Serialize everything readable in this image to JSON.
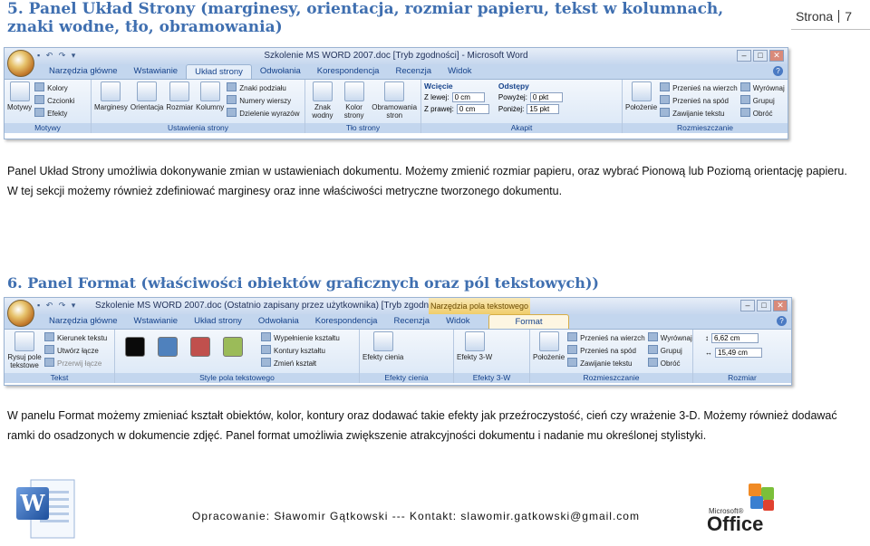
{
  "header": {
    "title": "5. Panel Układ Strony (marginesy, orientacja, rozmiar papieru, tekst w kolumnach, znaki wodne, tło, obramowania)",
    "page_label": "Strona",
    "page_number": "7"
  },
  "section5": {
    "paragraph": "Panel Układ Strony umożliwia dokonywanie zmian w ustawieniach dokumentu. Możemy zmienić rozmiar papieru, oraz wybrać Pionową lub Poziomą orientację papieru. W tej sekcji możemy również zdefiniować marginesy oraz inne właściwości metryczne tworzonego dokumentu."
  },
  "section6": {
    "title": "6. Panel Format (właściwości obiektów graficznych oraz pól tekstowych))",
    "paragraph": "W panelu Format możemy zmieniać kształt obiektów, kolor, kontury oraz dodawać takie efekty jak przeźroczystość, cień czy wrażenie 3-D. Możemy również dodawać ramki do osadzonych w dokumencie zdjęć. Panel format umożliwia zwiększenie atrakcyjności dokumentu i nadanie mu określonej stylistyki."
  },
  "ribbon1": {
    "caption": "Szkolenie MS WORD 2007.doc [Tryb zgodności] - Microsoft Word",
    "tabs": [
      "Narzędzia główne",
      "Wstawianie",
      "Układ strony",
      "Odwołania",
      "Korespondencja",
      "Recenzja",
      "Widok"
    ],
    "active_tab": 2,
    "groups": {
      "motywy": {
        "label": "Motywy",
        "big": "Motywy",
        "items": [
          "Kolory",
          "Czcionki",
          "Efekty"
        ]
      },
      "ustawienia": {
        "label": "Ustawienia strony",
        "big": [
          "Marginesy",
          "Orientacja",
          "Rozmiar",
          "Kolumny"
        ],
        "items": [
          "Znaki podziału",
          "Numery wierszy",
          "Dzielenie wyrazów"
        ]
      },
      "tlo": {
        "label": "Tło strony",
        "big": [
          "Znak wodny",
          "Kolor strony",
          "Obramowania stron"
        ]
      },
      "akapit": {
        "label": "Akapit",
        "wciecie": "Wcięcie",
        "left_label": "Z lewej:",
        "left_value": "0 cm",
        "right_label": "Z prawej:",
        "right_value": "0 cm",
        "odstepy": "Odstępy",
        "before_label": "Powyżej:",
        "before_value": "0 pkt",
        "after_label": "Poniżej:",
        "after_value": "15 pkt"
      },
      "rozmieszczanie": {
        "label": "Rozmieszczanie",
        "big": "Położenie",
        "items": [
          "Przenieś na wierzch",
          "Przenieś na spód",
          "Zawijanie tekstu"
        ],
        "items2": [
          "Wyrównaj",
          "Grupuj",
          "Obróć"
        ]
      }
    }
  },
  "ribbon2": {
    "caption": "Szkolenie MS WORD 2007.doc (Ostatnio zapisany przez użytkownika) [Tryb zgodności] - ...!",
    "context_header": "Narzędzia pola tekstowego",
    "tabs": [
      "Narzędzia główne",
      "Wstawianie",
      "Układ strony",
      "Odwołania",
      "Korespondencja",
      "Recenzja",
      "Widok"
    ],
    "context_tab": "Format",
    "groups": {
      "tekst": {
        "label": "Tekst",
        "big": "Rysuj pole tekstowe",
        "items": [
          "Kierunek tekstu",
          "Utwórz łącze",
          "Przerwij łącze"
        ]
      },
      "style": {
        "label": "Style pola tekstowego",
        "swatch_colors": [
          "#0a0a0a",
          "#4f81bd",
          "#c0504d",
          "#9bbb59"
        ],
        "items": [
          "Wypełnienie kształtu",
          "Kontury kształtu",
          "Zmień kształt"
        ]
      },
      "cien": {
        "label": "Efekty cienia",
        "big": "Efekty cienia"
      },
      "trojd": {
        "label": "Efekty 3-W",
        "big": "Efekty 3-W"
      },
      "rozmieszczanie": {
        "label": "Rozmieszczanie",
        "big": "Położenie",
        "items": [
          "Przenieś na wierzch",
          "Przenieś na spód",
          "Zawijanie tekstu"
        ],
        "items2": [
          "Wyrównaj",
          "Grupuj",
          "Obróć"
        ]
      },
      "rozmiar": {
        "label": "Rozmiar",
        "height": "6,62 cm",
        "width": "15,49 cm"
      }
    }
  },
  "footer": {
    "text": "Opracowanie: Sławomir Gątkowski --- Kontakt: slawomir.gatkowski@gmail.com",
    "office_ms": "Microsoft®",
    "office_brand": "Office"
  }
}
